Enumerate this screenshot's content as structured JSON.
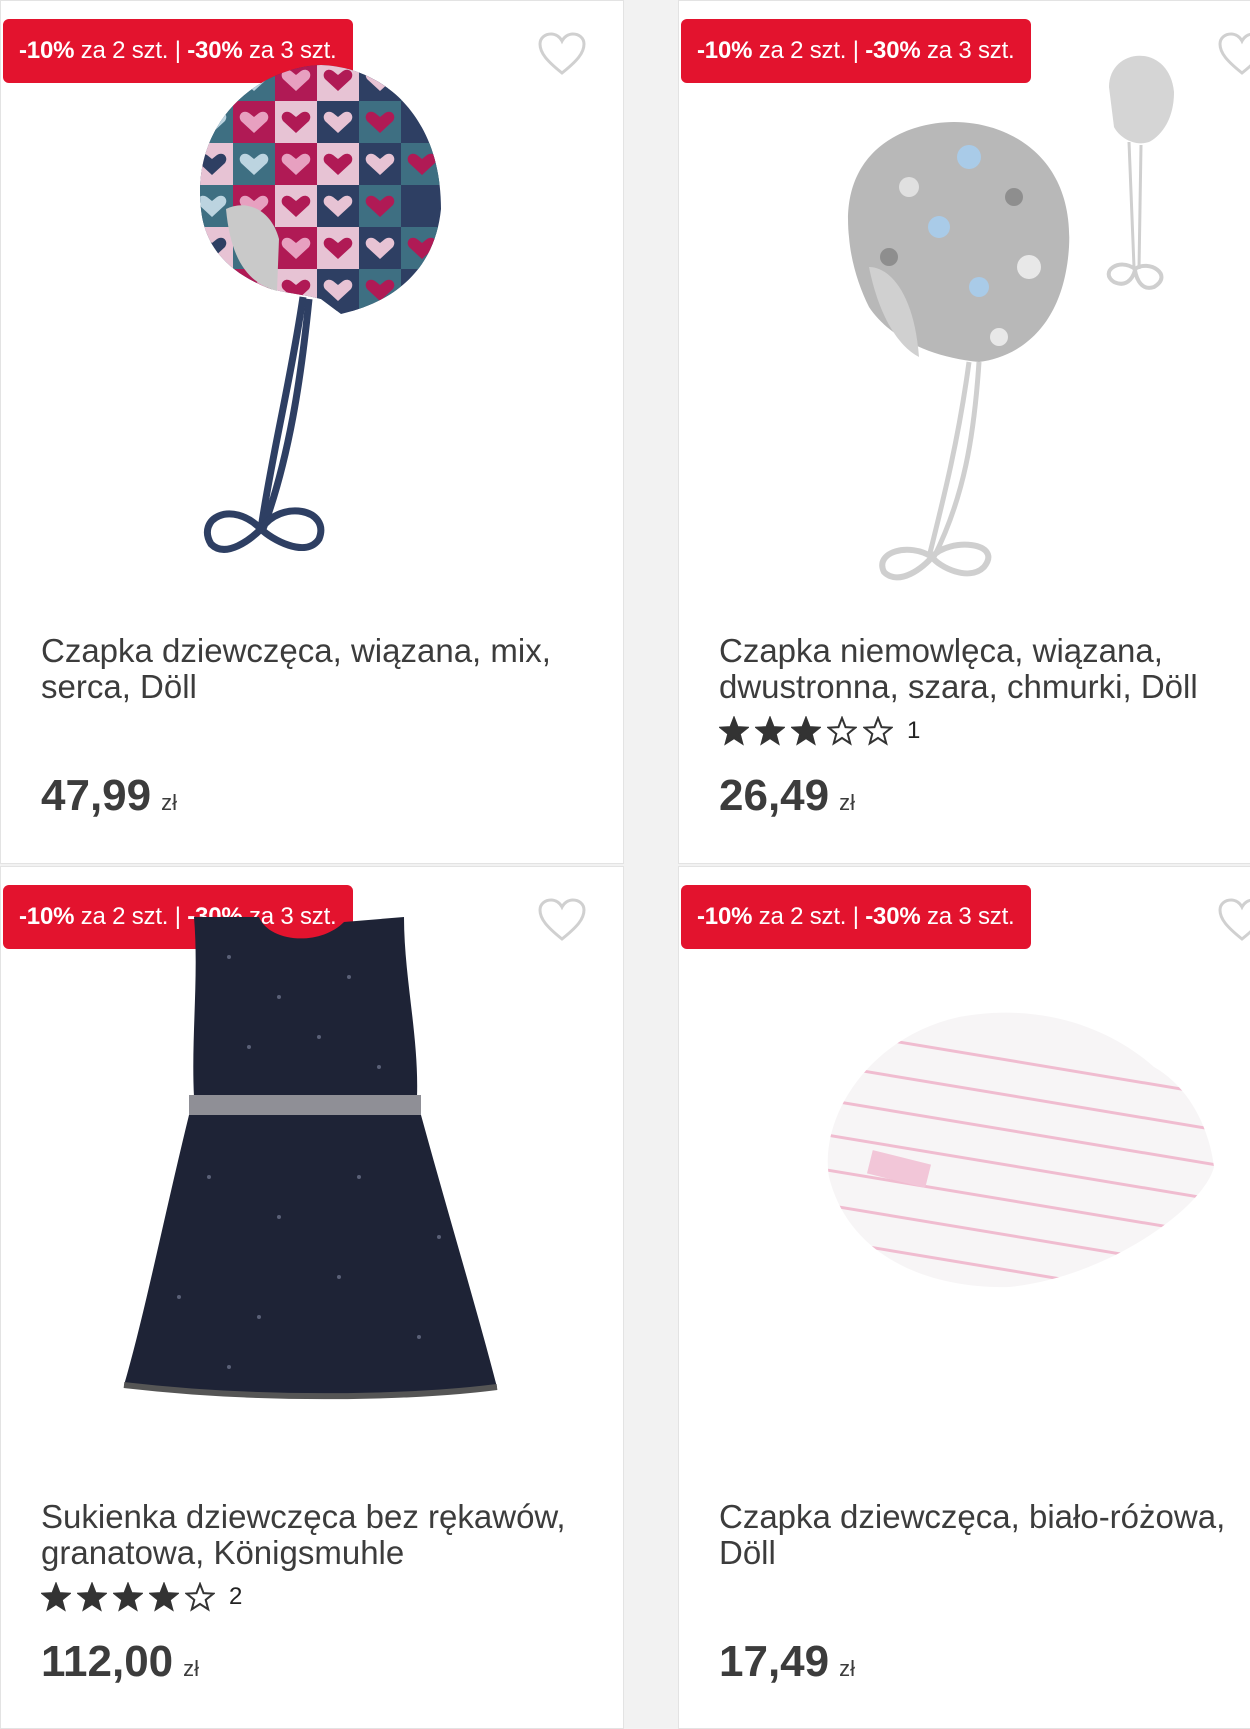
{
  "products": [
    {
      "badge_part1": "-10%",
      "badge_part2": " za 2 szt. | ",
      "badge_part3": "-30%",
      "badge_part4": " za 3 szt.",
      "title_line1": "Czapka dziewczęca, wiązana, mix,",
      "title_line2": "serca, Döll",
      "price": "47,99",
      "currency": "zł",
      "rating": null,
      "image": "knit-hat-hearts"
    },
    {
      "badge_part1": "-10%",
      "badge_part2": " za 2 szt. | ",
      "badge_part3": "-30%",
      "badge_part4": " za 3 szt.",
      "title_line1": "Czapka niemowlęca, wiązana,",
      "title_line2": "dwustronna, szara, chmurki, Döll",
      "price": "26,49",
      "currency": "zł",
      "rating": {
        "stars": 3,
        "max": 5,
        "count": "1"
      },
      "image": "grey-baby-hat-clouds"
    },
    {
      "badge_part1": "-10%",
      "badge_part2": " za 2 szt. | ",
      "badge_part3": "-30%",
      "badge_part4": " za 3 szt.",
      "title_line1": "Sukienka dziewczęca bez rękawów,",
      "title_line2": "granatowa, Königsmuhle",
      "price": "112,00",
      "currency": "zł",
      "rating": {
        "stars": 4,
        "max": 5,
        "count": "2"
      },
      "image": "navy-sleeveless-dress"
    },
    {
      "badge_part1": "-10%",
      "badge_part2": " za 2 szt. | ",
      "badge_part3": "-30%",
      "badge_part4": " za 3 szt.",
      "title_line1": "Czapka dziewczęca, biało-różowa,",
      "title_line2": "Döll",
      "price": "17,49",
      "currency": "zł",
      "rating": null,
      "image": "white-pink-striped-beanie"
    }
  ],
  "colors": {
    "badge": "#e3132e",
    "text": "#3c3c3c",
    "star": "#333333"
  },
  "icons": {
    "favorite": "heart-outline-icon",
    "star_full": "star-filled-icon",
    "star_empty": "star-outline-icon"
  }
}
